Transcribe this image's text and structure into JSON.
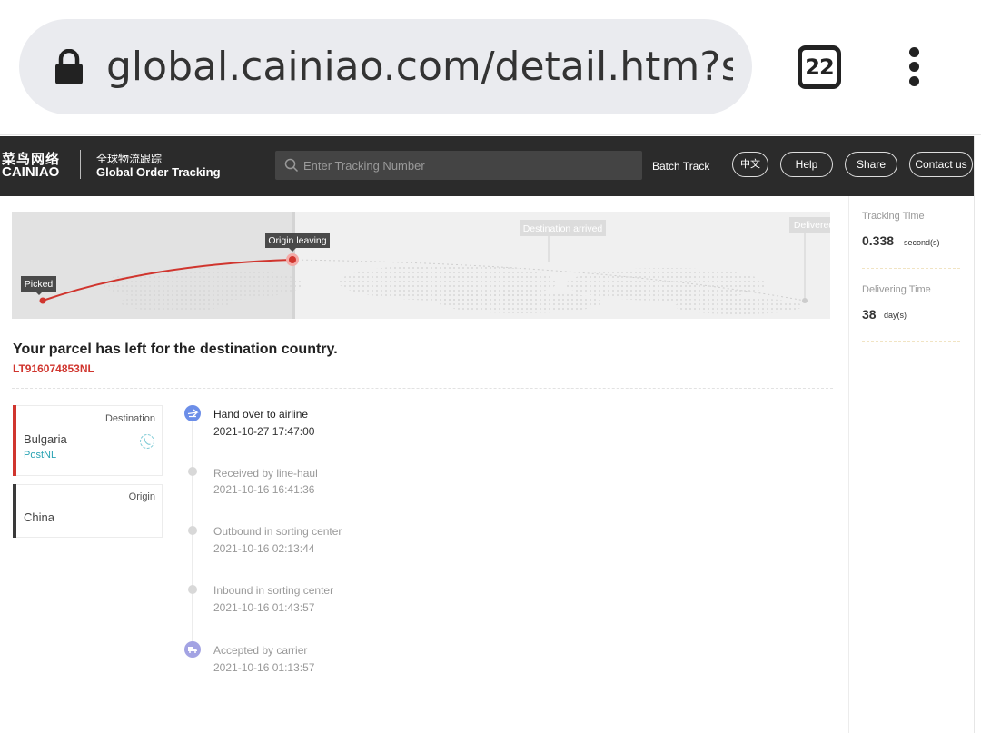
{
  "browser": {
    "url": "global.cainiao.com/detail.htm?spr",
    "tab_count": "22",
    "icons": [
      "lock-icon",
      "tab-switcher-icon",
      "overflow-menu-icon"
    ]
  },
  "header": {
    "logo_cn": "菜鸟网络",
    "logo_en": "CAINIAO",
    "subtitle_cn": "全球物流跟踪",
    "subtitle_en": "Global Order Tracking",
    "search_placeholder": "Enter Tracking Number",
    "batch_track": "Batch Track",
    "buttons": {
      "chinese": "中文",
      "help": "Help",
      "share": "Share",
      "contact": "Contact us"
    }
  },
  "progress": {
    "stages": [
      "Picked",
      "Origin leaving",
      "Destination arrived",
      "Delivered"
    ],
    "current_stage": "Origin leaving"
  },
  "parcel": {
    "status_title": "Your parcel has left for the destination country.",
    "tracking_number": "LT916074853NL"
  },
  "destination": {
    "label": "Destination",
    "country": "Bulgaria",
    "carrier": "PostNL"
  },
  "origin": {
    "label": "Origin",
    "country": "China"
  },
  "events": [
    {
      "desc": "Hand over to airline",
      "time": "2021-10-27 17:47:00",
      "active": true,
      "icon": "airplane-icon"
    },
    {
      "desc": "Received by line-haul",
      "time": "2021-10-16 16:41:36"
    },
    {
      "desc": "Outbound in sorting center",
      "time": "2021-10-16 02:13:44"
    },
    {
      "desc": "Inbound in sorting center",
      "time": "2021-10-16 01:43:57"
    },
    {
      "desc": "Accepted by carrier",
      "time": "2021-10-16 01:13:57",
      "icon": "truck-icon"
    }
  ],
  "stats": {
    "tracking_time_label": "Tracking Time",
    "tracking_time_value": "0.338",
    "tracking_time_unit": "second(s)",
    "delivering_time_label": "Delivering Time",
    "delivering_time_value": "38",
    "delivering_time_unit": "day(s)"
  },
  "colors": {
    "accent_red": "#d0352e",
    "header_bg": "#2b2b2b",
    "carrier_teal": "#2aa3b3",
    "event_icon_blue": "#6c8ee8"
  }
}
